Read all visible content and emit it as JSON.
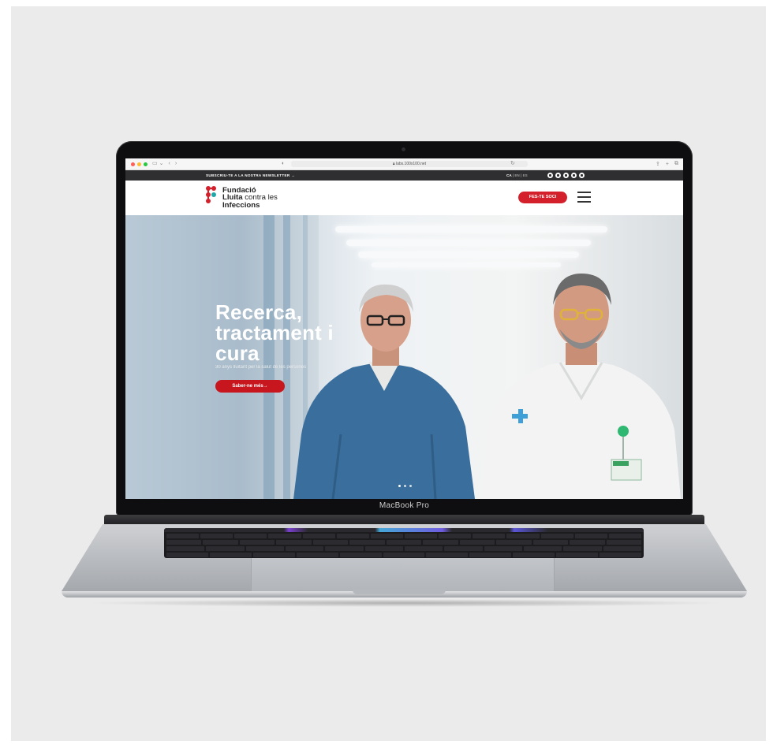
{
  "browser": {
    "url": "labs.100x100.net",
    "nav_icons": [
      "sidebar-icon",
      "chevron-down-icon",
      "back-icon",
      "forward-icon"
    ],
    "shield_icon": "shield-icon",
    "reload_icon": "reload-icon",
    "right_icons": [
      "share-icon",
      "plus-icon",
      "tabs-icon"
    ],
    "traffic_colors": [
      "#ff5f57",
      "#febc2e",
      "#28c840"
    ]
  },
  "laptop": {
    "label": "MacBook Pro"
  },
  "topbar": {
    "newsletter": "SUBSCRIU-TE A LA NOSTRA NEWSLETTER →",
    "languages": [
      {
        "code": "CA",
        "active": true
      },
      {
        "code": "EN",
        "active": false
      },
      {
        "code": "ES",
        "active": false
      }
    ],
    "separator": "|",
    "social": [
      "facebook-icon",
      "instagram-icon",
      "twitter-icon",
      "linkedin-icon",
      "youtube-icon"
    ]
  },
  "header": {
    "logo_line1": "Fundació",
    "logo_line2_bold": "Lluita",
    "logo_line2_rest": " contra les",
    "logo_line3": "Infeccions",
    "cta": "FES-TE SOCI",
    "menu_icon": "hamburger-icon",
    "brand_red": "#d4202b",
    "brand_teal": "#1fa6a8"
  },
  "hero": {
    "title_line1": "Recerca,",
    "title_line2": "tractament i",
    "title_line3": "cura",
    "subtitle": "30 anys lluitant per la salut de les persones",
    "button": "Saber-ne més→",
    "slides_total": 3,
    "slide_active": 1
  }
}
